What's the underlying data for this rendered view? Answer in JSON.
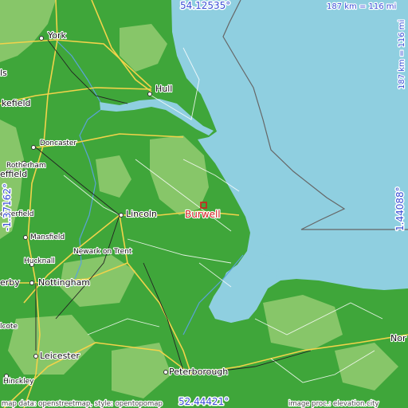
{
  "map": {
    "target": {
      "name": "Burwell",
      "color": "#d21e1e"
    },
    "cities": [
      {
        "name": "York"
      },
      {
        "name": "Hull"
      },
      {
        "name": "Doncaster"
      },
      {
        "name": "Rotherham"
      },
      {
        "name": "Lincoln"
      },
      {
        "name": "Mansfield"
      },
      {
        "name": "Newark on Trent"
      },
      {
        "name": "Hucknall"
      },
      {
        "name": "Nottingham"
      },
      {
        "name": "Leicester"
      },
      {
        "name": "Peterborough"
      },
      {
        "name": "Hinckley"
      }
    ],
    "cropped_labels": {
      "left_top": "ls",
      "left_mid1": "kefield",
      "left_mid2": "effield",
      "left_mid3": "esterfield",
      "left_derby": "erby",
      "left_coalville": "lcote",
      "right_norwich": "Nor"
    },
    "coordinates": {
      "top": "54.12535°",
      "bottom": "52.44421°",
      "left": "-1.37162°",
      "right": "1.44088°"
    },
    "scale": {
      "horizontal": "187 km = 116 mi",
      "vertical": "187 km = 116 mi"
    },
    "credits": {
      "left": "map data: openstreetmap, style: opentopomap",
      "right": "image proc.: elevation.city"
    },
    "colors": {
      "sea": "#8fcfe0",
      "lowland": "#3fa63a",
      "upland": "#8fca6f",
      "coordinate_text": "#3b4fd6",
      "target": "#d21e1e",
      "roads": "#f2d34a"
    }
  }
}
